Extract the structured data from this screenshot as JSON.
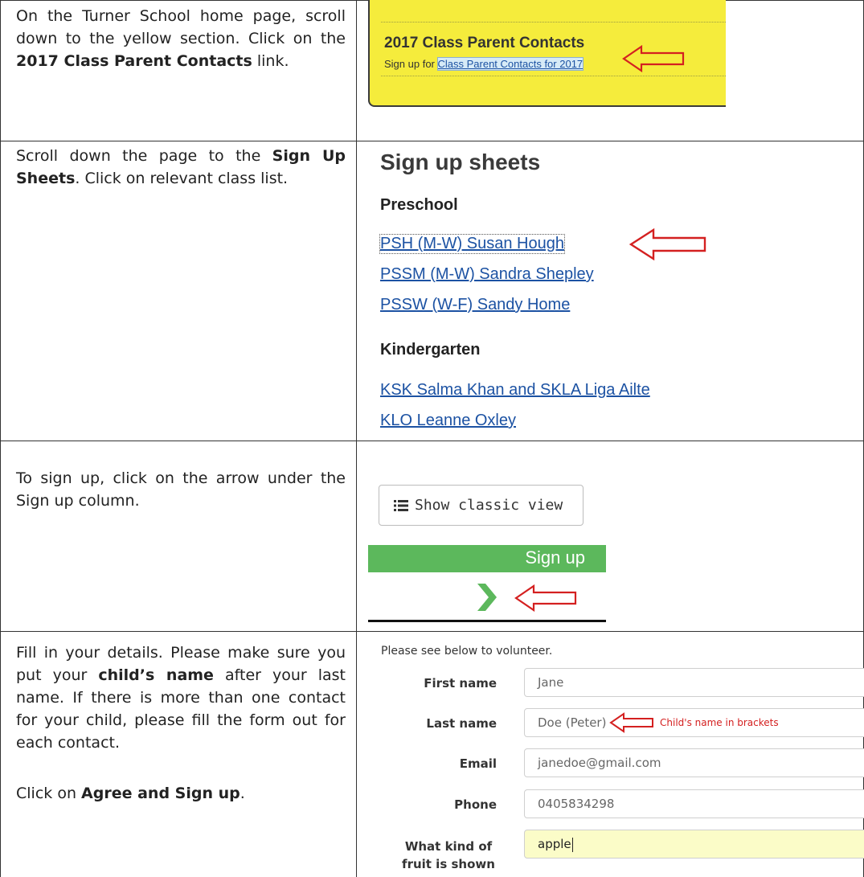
{
  "rows": [
    {
      "instruction_parts": [
        "On the Turner School home page, scroll down to the yellow section. Click on the ",
        "2017 Class Parent Contacts",
        " link."
      ]
    },
    {
      "instruction_parts": [
        "Scroll down the page to the ",
        "Sign Up Sheets",
        ". Click on relevant class list."
      ]
    },
    {
      "instruction_parts": [
        "To sign up, click on the arrow under the Sign up column."
      ]
    },
    {
      "instruction_parts": [
        "Fill in your details. Please make sure you put your ",
        "child’s name",
        " after your last name. If there is more than one contact for your child, please fill the form out for each contact."
      ],
      "instruction2_parts": [
        "Click on ",
        "Agree and Sign up",
        "."
      ]
    }
  ],
  "yellow_section": {
    "title": "2017 Class Parent Contacts",
    "sub_prefix": "Sign up for ",
    "link_text": "Class Parent Contacts for 2017"
  },
  "sheets": {
    "title": "Sign up sheets",
    "preschool_heading": "Preschool",
    "preschool_links": [
      "PSH (M-W) Susan Hough",
      "PSSM (M-W) Sandra Shepley",
      "PSSW (W-F) Sandy Home"
    ],
    "kindergarten_heading": "Kindergarten",
    "kindergarten_links": [
      "KSK Salma Khan and SKLA Liga Ailte",
      "KLO Leanne Oxley"
    ]
  },
  "signup": {
    "classic_view_label": "Show classic view",
    "column_header": "Sign up"
  },
  "form": {
    "intro": "Please see below to volunteer.",
    "fields": [
      {
        "label": "First name",
        "value": "Jane"
      },
      {
        "label": "Last name",
        "value": "Doe (Peter)"
      },
      {
        "label": "Email",
        "value": "janedoe@gmail.com"
      },
      {
        "label": "Phone",
        "value": "0405834298"
      },
      {
        "label": "What kind of fruit is shown",
        "value": "apple"
      }
    ],
    "child_note": "Child's name in brackets"
  },
  "colors": {
    "yellow": "#f5ec3c",
    "green": "#5cb85c",
    "arrow_red": "#d42020",
    "link_blue": "#1c52a3"
  }
}
